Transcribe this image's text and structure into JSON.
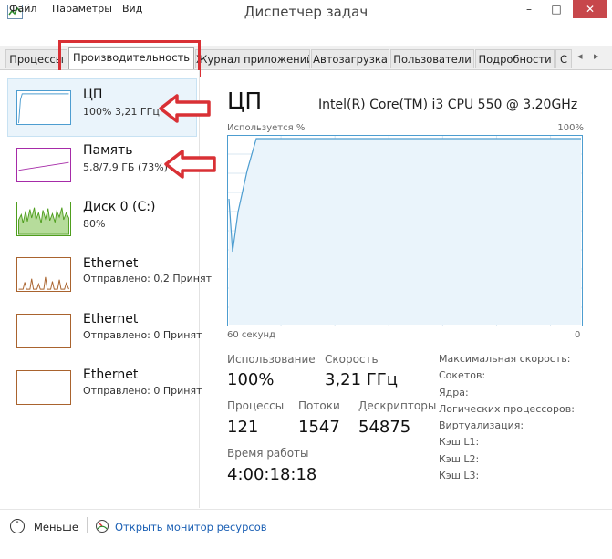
{
  "window": {
    "title": "Диспетчер задач",
    "min_glyph": "–",
    "max_glyph": "□",
    "close_glyph": "✕"
  },
  "menu": [
    "Файл",
    "Параметры",
    "Вид"
  ],
  "tabs": [
    {
      "label": "Процессы",
      "active": false
    },
    {
      "label": "Производительность",
      "active": true
    },
    {
      "label": "Журнал приложений",
      "active": false
    },
    {
      "label": "Автозагрузка",
      "active": false
    },
    {
      "label": "Пользователи",
      "active": false
    },
    {
      "label": "Подробности",
      "active": false
    },
    {
      "label": "С",
      "active": false
    }
  ],
  "tab_scroll": {
    "left": "◂",
    "right": "▸"
  },
  "sidebar": [
    {
      "title": "ЦП",
      "subtitle": "100% 3,21 ГГц",
      "color": "#4d9dd0",
      "selected": true
    },
    {
      "title": "Память",
      "subtitle": "5,8/7,9 ГБ (73%)",
      "color": "#a62ba8",
      "selected": false
    },
    {
      "title": "Диск 0 (C:)",
      "subtitle": "80%",
      "color": "#4f9e1e",
      "selected": false
    },
    {
      "title": "Ethernet",
      "subtitle": "Отправлено: 0,2 Принят",
      "color": "#a9632e",
      "selected": false
    },
    {
      "title": "Ethernet",
      "subtitle": "Отправлено: 0 Принят",
      "color": "#a9632e",
      "selected": false
    },
    {
      "title": "Ethernet",
      "subtitle": "Отправлено: 0 Принят",
      "color": "#a9632e",
      "selected": false
    }
  ],
  "main": {
    "title": "ЦП",
    "cpu_model": "Intel(R) Core(TM) i3 CPU 550 @ 3.20GHz",
    "graph": {
      "label_left": "Используется %",
      "label_right": "100%",
      "axis_left": "60 секунд",
      "axis_right": "0",
      "line_color": "#4d9dd0",
      "fill_color": "#eaf4fb",
      "usage_series": [
        2,
        60,
        82,
        100,
        100,
        100,
        100,
        100,
        100,
        100,
        100,
        100,
        100,
        100,
        100,
        100
      ]
    },
    "stats": {
      "usage_label": "Использование",
      "usage_value": "100%",
      "speed_label": "Скорость",
      "speed_value": "3,21 ГГц",
      "processes_label": "Процессы",
      "processes_value": "121",
      "threads_label": "Потоки",
      "threads_value": "1547",
      "handles_label": "Дескрипторы",
      "handles_value": "54875",
      "uptime_label": "Время работы",
      "uptime_value": "4:00:18:18"
    },
    "specs": [
      "Максимальная скорость:",
      "Сокетов:",
      "Ядра:",
      "Логических процессоров:",
      "Виртуализация:",
      "Кэш L1:",
      "Кэш L2:",
      "Кэш L3:"
    ]
  },
  "footer": {
    "less_label": "Меньше",
    "monitor_link": "Открыть монитор ресурсов"
  },
  "annotation_color": "#d93035"
}
